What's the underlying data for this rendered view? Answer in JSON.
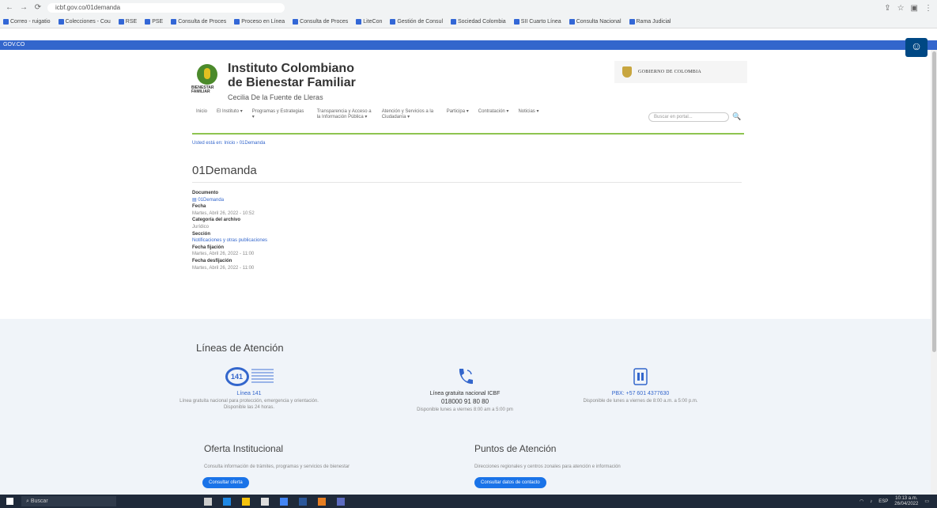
{
  "browser": {
    "url": "icbf.gov.co/01demanda",
    "bookmarks": [
      "Correo - ruigatio",
      "Colecciones - Cou",
      "RSE",
      "PSE",
      "Consulta de Proces",
      "Proceso en Línea",
      "Consulta de Proces",
      "LiteCon",
      "Gestión de Consul",
      "Sociedad Colombia",
      "SII Cuarto Línea",
      "Consulta Nacional",
      "Rama Judicial"
    ]
  },
  "govco": {
    "label": "GOV.CO"
  },
  "header": {
    "logo_text": "BIENESTAR FAMILIAR",
    "inst_line1": "Instituto Colombiano",
    "inst_line2": "de Bienestar Familiar",
    "subtitle": "Cecilia De la Fuente de Lleras",
    "gobierno": "GOBIERNO DE COLOMBIA"
  },
  "menu": {
    "items": [
      "Inicio",
      "El Instituto ▾",
      "Programas y Estrategias ▾",
      "Transparencia y Acceso a la Información Pública ▾",
      "Atención y Servicios a la Ciudadanía ▾",
      "Participa ▾",
      "Contratación ▾",
      "Noticias ▾"
    ],
    "search_placeholder": "Buscar en portal..."
  },
  "breadcrumb": {
    "prefix": "Usted está en:",
    "path": "Inicio › 01Demanda"
  },
  "page": {
    "title": "01Demanda"
  },
  "details": {
    "documento_label": "Documento",
    "documento_value": "01Demanda",
    "fecha_label": "Fecha",
    "fecha_value": "Martes, Abril 26, 2022 - 10:52",
    "categoria_label": "Categoría del archivo",
    "categoria_value": "Jurídico",
    "seccion_label": "Sección",
    "seccion_value": "Notificaciones y otras publicaciones",
    "fijacion_label": "Fecha fijación",
    "fijacion_value": "Martes, Abril 26, 2022 - 11:00",
    "desfijacion_label": "Fecha desfijación",
    "desfijacion_value": "Martes, Abril 26, 2022 - 11:00"
  },
  "footer": {
    "lineas_title": "Líneas de Atención",
    "icon_141_text": "141",
    "col1_name": "Línea 141",
    "col1_desc": "Línea gratuita nacional para protección, emergencia y orientación. Disponible las 24 horas.",
    "col2_name": "Línea gratuita nacional ICBF",
    "col2_number": "018000 91 80 80",
    "col2_desc": "Disponible lunes a viernes 8:00 am a 5:00 pm",
    "col3_name": "PBX: +57 601 4377630",
    "col3_desc": "Disponible de lunes a viernes de 8:00 a.m. a 5:00 p.m.",
    "oferta_title": "Oferta Institucional",
    "oferta_desc": "Consulta información de trámites, programas y servicios de bienestar",
    "oferta_btn": "Consultar oferta",
    "puntos_title": "Puntos de Atención",
    "puntos_desc": "Direcciones regionales y centros zonales para atención e información",
    "puntos_btn": "Consultar datos de contacto"
  },
  "taskbar": {
    "search": "Buscar",
    "time": "10:13 a.m.",
    "date": "26/04/2022"
  }
}
